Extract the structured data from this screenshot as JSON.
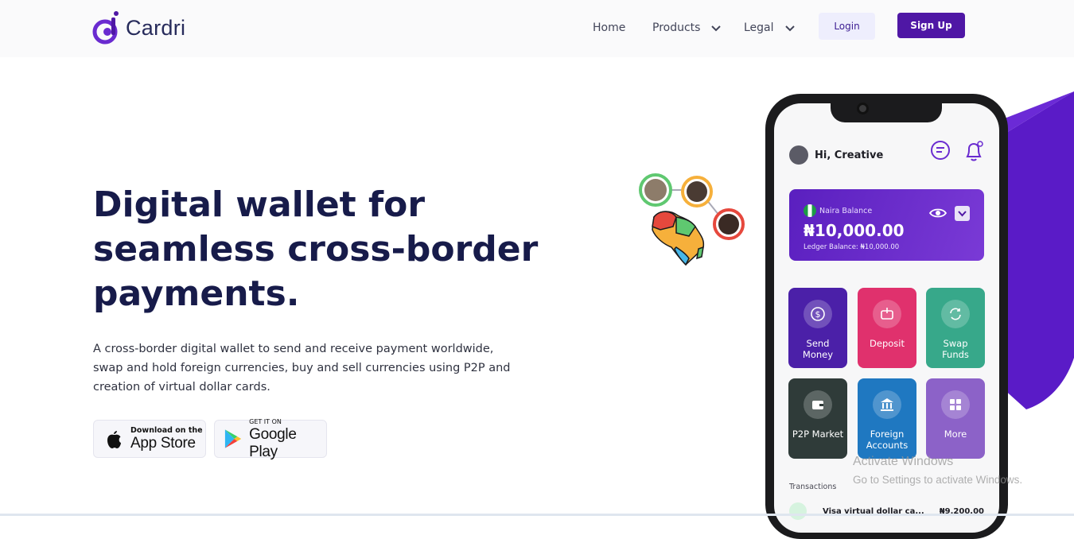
{
  "brand": {
    "name": "Cardri",
    "accent": "#4f17a5"
  },
  "nav": {
    "home": "Home",
    "products": "Products",
    "legal": "Legal",
    "login": "Login",
    "signup": "Sign Up"
  },
  "hero": {
    "title_line1": "Digital wallet for",
    "title_line2": "seamless cross-border",
    "title_line3": "payments.",
    "description": "A cross-border digital wallet to send and receive payment worldwide, swap and hold foreign currencies, buy and sell currencies using P2P and creation of virtual dollar cards."
  },
  "stores": {
    "apple_small": "Download on the",
    "apple_big": "App Store",
    "google_small": "GET IT ON",
    "google_big": "Google Play"
  },
  "phone": {
    "greeting": "Hi, Creative",
    "balance_label": "Naira Balance",
    "balance_amount": "₦10,000.00",
    "ledger": "Ledger Balance: ₦10,000.00",
    "tiles": [
      {
        "line1": "Send",
        "line2": "Money",
        "icon": "dollar-icon"
      },
      {
        "line1": "Deposit",
        "line2": "",
        "icon": "deposit-icon"
      },
      {
        "line1": "Swap",
        "line2": "Funds",
        "icon": "swap-icon"
      },
      {
        "line1": "P2P Market",
        "line2": "",
        "icon": "wallet-icon"
      },
      {
        "line1": "Foreign",
        "line2": "Accounts",
        "icon": "bank-icon"
      },
      {
        "line1": "More",
        "line2": "",
        "icon": "grid-icon"
      }
    ],
    "transactions_label": "Transactions",
    "transaction": {
      "name": "Visa virtual dollar ca...",
      "amount": "₦9,200.00"
    }
  },
  "overlay": {
    "line1": "Activate Windows",
    "line2": "Go to Settings to activate Windows."
  }
}
